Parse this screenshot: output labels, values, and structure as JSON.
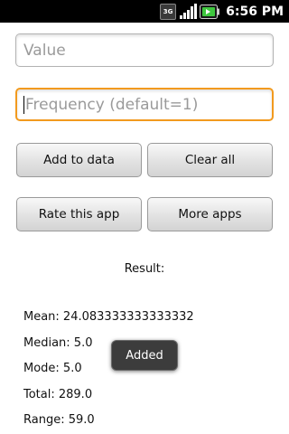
{
  "status_bar": {
    "network_type": "3G",
    "time": "6:56 PM",
    "icons": [
      "3g-icon",
      "signal-icon",
      "battery-icon"
    ]
  },
  "form": {
    "value_placeholder": "Value",
    "frequency_placeholder": "Frequency (default=1)",
    "frequency_focused": true
  },
  "buttons": {
    "add_to_data": "Add to data",
    "clear_all": "Clear all",
    "rate_this_app": "Rate this app",
    "more_apps": "More apps"
  },
  "result": {
    "label": "Result:",
    "mean": "Mean: 24.083333333333332",
    "median": "Median: 5.0",
    "mode": "Mode: 5.0",
    "total": "Total: 289.0",
    "range": "Range: 59.0"
  },
  "toast": {
    "message": "Added"
  },
  "colors": {
    "status_bar_bg": "#000000",
    "focus_border": "#f29a1e",
    "battery_green": "#3ec73e",
    "toast_bg": "#3c3c3c"
  }
}
